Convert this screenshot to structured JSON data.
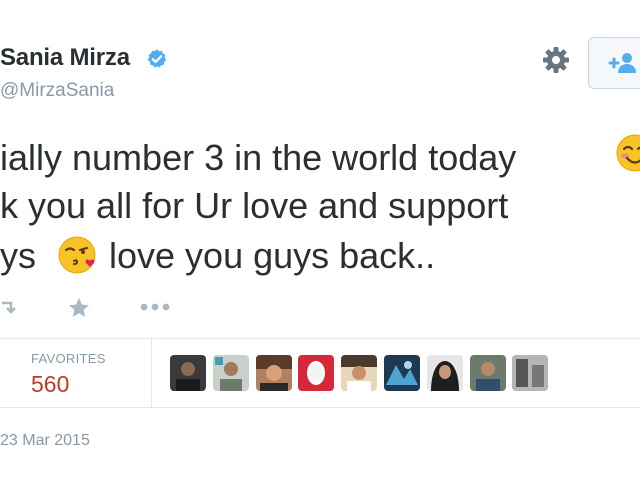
{
  "tweet": {
    "author_name": "Sania Mirza",
    "author_handle": "@MirzaSania",
    "text_line_1": "ially number 3 in the world today",
    "text_line_2": "k you all for Ur love and support",
    "text_line_3a": "ys",
    "text_line_3b": "love you guys back..",
    "emoji_1": "smiling-face-icon",
    "emoji_2": "face-blowing-kiss-icon",
    "date": "23 Mar 2015"
  },
  "stats": {
    "favorites_label": "FAVORITES",
    "favorites_count": "560",
    "favorites_color": "#c0392b"
  },
  "favoriters": [
    {
      "name": "favoriter-avatar-1",
      "bg": "#3a3a3a"
    },
    {
      "name": "favoriter-avatar-2",
      "bg": "#9aa39a"
    },
    {
      "name": "favoriter-avatar-3",
      "bg": "#b08060"
    },
    {
      "name": "favoriter-avatar-4",
      "bg": "#d62839"
    },
    {
      "name": "favoriter-avatar-5",
      "bg": "#c8a070"
    },
    {
      "name": "favoriter-avatar-6",
      "bg": "#3f6d8e"
    },
    {
      "name": "favoriter-avatar-7",
      "bg": "#2c2c2c"
    },
    {
      "name": "favoriter-avatar-8",
      "bg": "#6b7a6a"
    },
    {
      "name": "favoriter-avatar-9",
      "bg": "#8a8a8a"
    }
  ],
  "icons": {
    "verified": "verified-badge-icon",
    "settings": "gear-icon",
    "follow": "follow-person-icon",
    "retweet": "retweet-icon",
    "favorite": "star-icon",
    "more": "more-dots-icon"
  },
  "colors": {
    "text": "#292f33",
    "muted": "#8899a6",
    "verified_blue": "#55acee",
    "follow_blue": "#55acee"
  }
}
